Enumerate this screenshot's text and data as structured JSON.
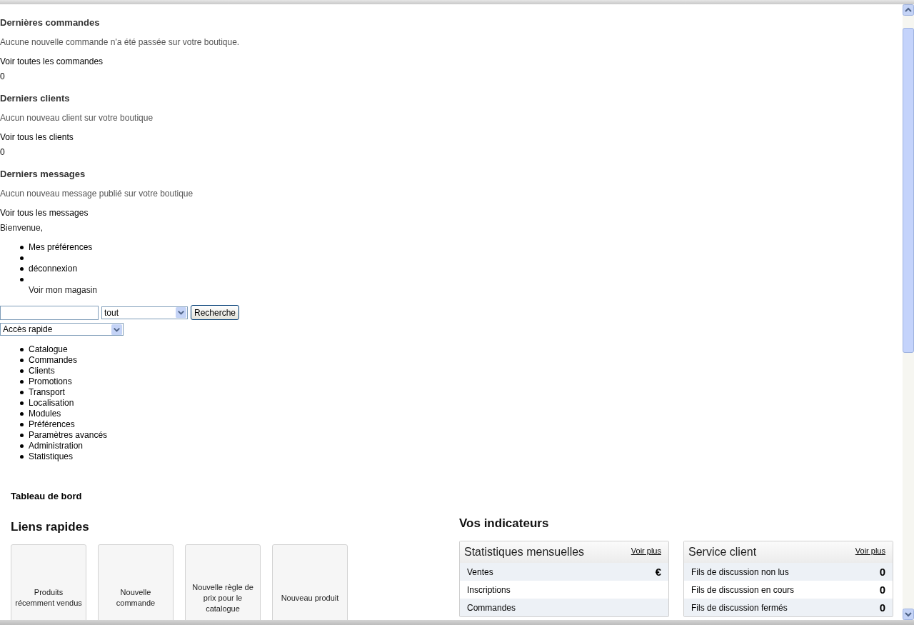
{
  "sections": [
    {
      "title": "Dernières commandes",
      "message": "Aucune nouvelle commande n'a été passée sur votre boutique.",
      "link": "Voir toutes les commandes",
      "count": "0"
    },
    {
      "title": "Derniers clients",
      "message": "Aucun nouveau client sur votre boutique",
      "link": "Voir tous les clients",
      "count": "0"
    },
    {
      "title": "Derniers messages",
      "message": "Aucun nouveau message publié sur votre boutique",
      "link": "Voir tous les messages"
    }
  ],
  "welcome": "Bienvenue,",
  "user_menu": [
    {
      "kind": "link",
      "label": "Mes préférences"
    },
    {
      "kind": "empty"
    },
    {
      "kind": "link",
      "label": "déconnexion"
    },
    {
      "kind": "below",
      "label": "Voir mon magasin"
    }
  ],
  "search": {
    "scope": "tout",
    "button": "Recherche"
  },
  "quick_access": "Accès rapide",
  "nav": [
    "Catalogue",
    "Commandes",
    "Clients",
    "Promotions",
    "Transport",
    "Localisation",
    "Modules",
    "Préférences",
    "Paramètres avancés",
    "Administration",
    "Statistiques"
  ],
  "page_title": "Tableau de bord",
  "quick_links": {
    "title": "Liens rapides",
    "items": [
      "Produits récemment vendus",
      "Nouvelle commande",
      "Nouvelle règle de prix pour le catalogue",
      "Nouveau produit"
    ]
  },
  "indicators": {
    "title": "Vos indicateurs",
    "panels": [
      {
        "title": "Statistiques mensuelles",
        "more": "Voir plus",
        "rows": [
          {
            "label": "Ventes",
            "value": "€"
          },
          {
            "label": "Inscriptions"
          },
          {
            "label": "Commandes"
          }
        ]
      },
      {
        "title": "Service client",
        "more": "Voir plus",
        "rows": [
          {
            "label": "Fils de discussion non lus",
            "value": "0"
          },
          {
            "label": "Fils de discussion en cours",
            "value": "0"
          },
          {
            "label": "Fils de discussion fermés",
            "value": "0"
          }
        ]
      }
    ]
  }
}
